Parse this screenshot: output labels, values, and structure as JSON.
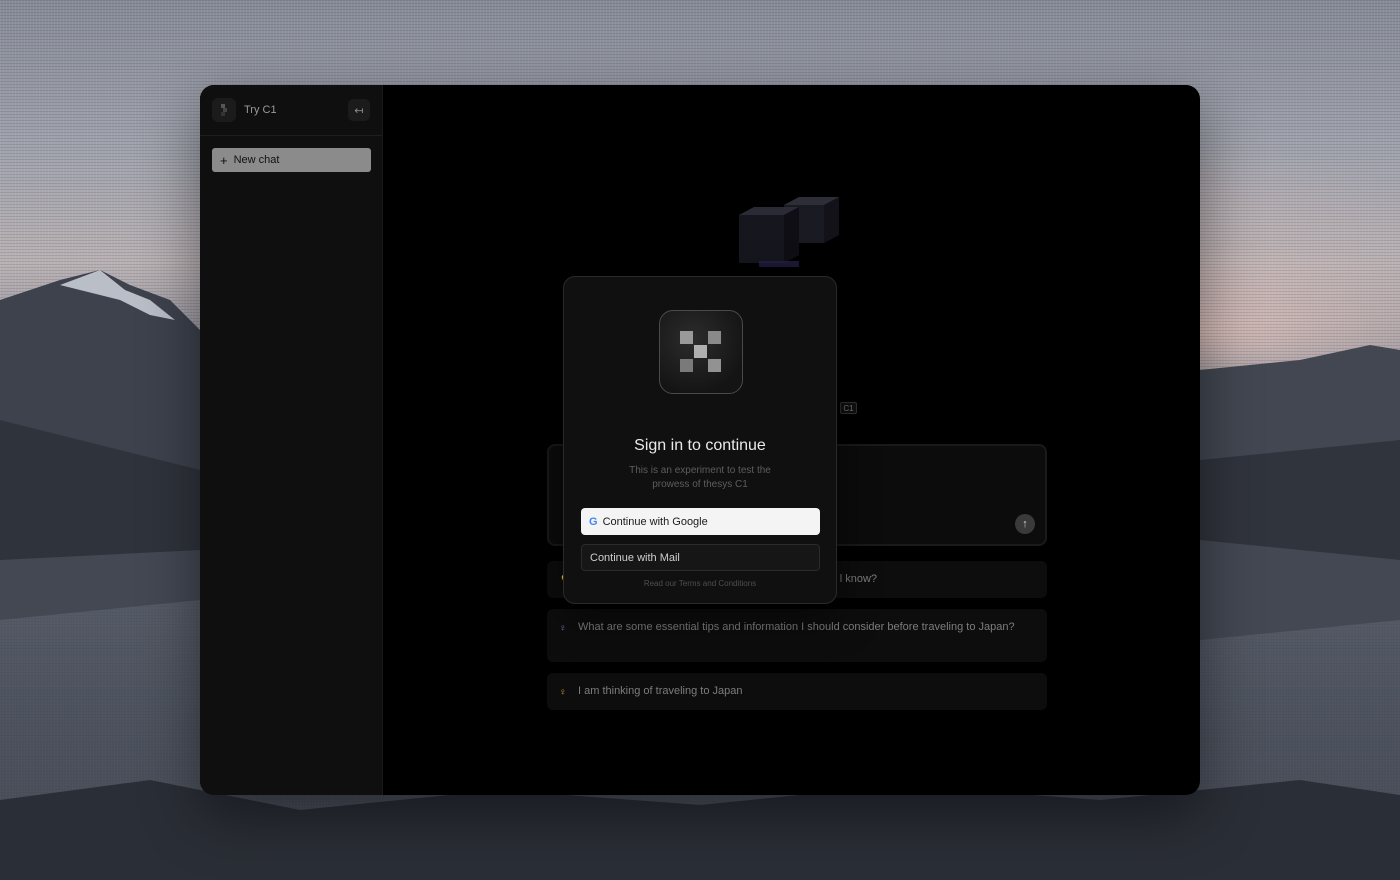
{
  "sidebar": {
    "title": "Try C1",
    "collapse_icon": "↤",
    "new_chat_label": "New chat"
  },
  "main": {
    "badge": "C1",
    "send_icon": "↑",
    "suggestions": [
      {
        "text": "l know?",
        "icon_color": "#888888"
      },
      {
        "text": "What are some essential tips and information I should consider before traveling to Japan?",
        "icon_color": "#8a6fc9"
      },
      {
        "text": "I am thinking of traveling to Japan",
        "icon_color": "#c99a3a"
      }
    ]
  },
  "modal": {
    "title": "Sign in to continue",
    "subtitle": "This is an experiment to test the prowess of thesys C1",
    "google_label": "Continue with Google",
    "mail_label": "Continue with Mail",
    "terms": "Read our Terms and Conditions"
  }
}
